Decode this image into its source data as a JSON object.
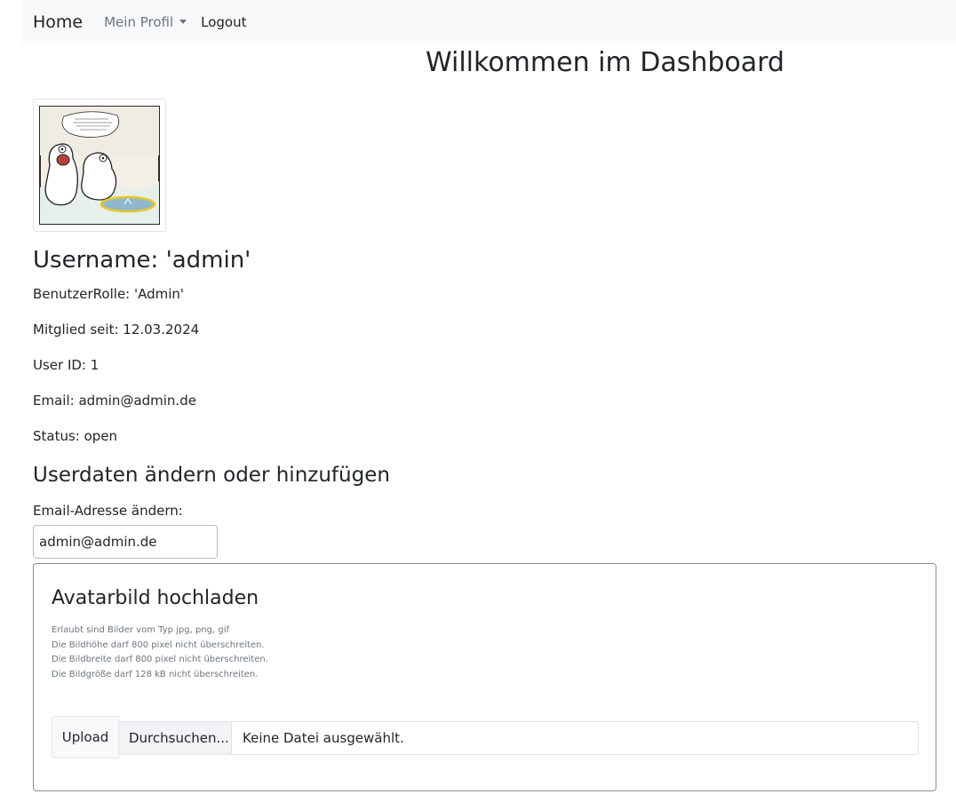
{
  "nav": {
    "home": "Home",
    "profile": "Mein Profil",
    "logout": "Logout"
  },
  "dashboard": {
    "title": "Willkommen im Dashboard"
  },
  "user": {
    "username_line": "Username: 'admin'",
    "role_line": "BenutzerRolle: 'Admin'",
    "member_since_line": "Mitglied seit: 12.03.2024",
    "user_id_line": "User ID: 1",
    "email_line": "Email: admin@admin.de",
    "status_line": "Status: open"
  },
  "edit": {
    "title": "Userdaten ändern oder hinzufügen",
    "email_label": "Email-Adresse ändern:",
    "email_value": "admin@admin.de"
  },
  "upload": {
    "title": "Avatarbild hochladen",
    "hints": [
      "Erlaubt sind Bilder vom Typ jpg, png, gif",
      "Die Bildhöhe darf 800 pixel nicht überschreiten.",
      "Die Bildbreite darf 800 pixel nicht überschreiten.",
      "Die Bildgröße darf 128 kB nicht überschreiten."
    ],
    "upload_button": "Upload",
    "browse_button": "Durchsuchen...",
    "no_file": "Keine Datei ausgewählt."
  },
  "avatar": {
    "icon": "polar-bear-cartoon-image"
  },
  "colors": {
    "navbar_bg": "#f8f9fa",
    "text": "#212529",
    "muted": "#6c757d"
  }
}
